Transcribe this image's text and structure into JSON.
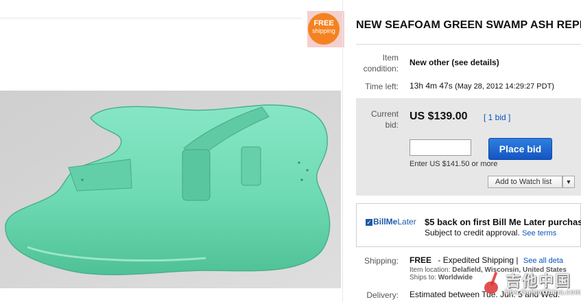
{
  "badge": {
    "line1": "FREE",
    "line2": "shipping"
  },
  "title": "NEW SEAFOAM GREEN SWAMP ASH REPL",
  "condition": {
    "label": "Item condition:",
    "value": "New other (see details)"
  },
  "time_left": {
    "label": "Time left:",
    "value": "13h 4m 47s",
    "ends": "(May 28, 2012 14:29:27 PDT)"
  },
  "bid": {
    "label": "Current bid:",
    "price": "US $139.00",
    "bids_link": "[ 1 bid ]",
    "place_bid": "Place bid",
    "enter": "Enter US $141.50 or more",
    "watch": "Add to Watch list",
    "watch_arrow": "▼"
  },
  "billmelater": {
    "logo_bill": "Bill",
    "logo_me": "Me",
    "logo_later": "Later",
    "line1": "$5 back on first Bill Me Later purchas",
    "line2": "Subject to credit approval.",
    "see_terms": "See terms"
  },
  "shipping": {
    "label": "Shipping:",
    "free": "FREE",
    "method": "- Expedited Shipping |",
    "see_all": "See all deta",
    "location_label": "Item location:",
    "location_value": "Delafield, Wisconsin, United States",
    "ships_label": "Ships to:",
    "ships_value": "Worldwide"
  },
  "delivery": {
    "label": "Delivery:",
    "value": "Estimated between Tue. Jun. 5 and Wed."
  },
  "watermark": {
    "text": "吉他中国",
    "url": "bbs.GuitarChina.com"
  },
  "colors": {
    "guitar": "#6fdcb6",
    "accent": "#0654ba",
    "badge": "#f58220"
  }
}
